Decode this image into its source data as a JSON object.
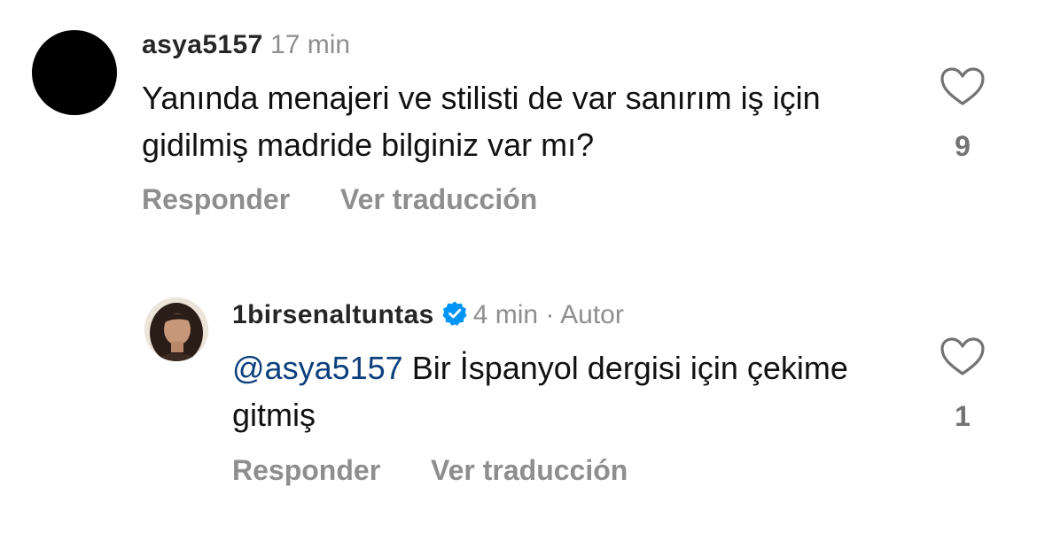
{
  "comments": [
    {
      "username": "asya5157",
      "time": "17 min",
      "text": "Yanında menajeri ve stilisti de var sanırım iş için gidilmiş madride bilginiz var mı?",
      "reply_label": "Responder",
      "translate_label": "Ver traducción",
      "likes": "9",
      "avatar_color": "#000000"
    },
    {
      "username": "1birsenaltuntas",
      "verified": true,
      "time": "4 min",
      "separator": "·",
      "author_badge": "Autor",
      "mention": "@asya5157",
      "text": " Bir İspanyol dergisi için çekime gitmiş",
      "reply_label": "Responder",
      "translate_label": "Ver traducción",
      "likes": "1"
    }
  ],
  "colors": {
    "mention": "#0c3f7d",
    "verified": "#0095f6",
    "secondary_text": "#8e8e8e"
  }
}
